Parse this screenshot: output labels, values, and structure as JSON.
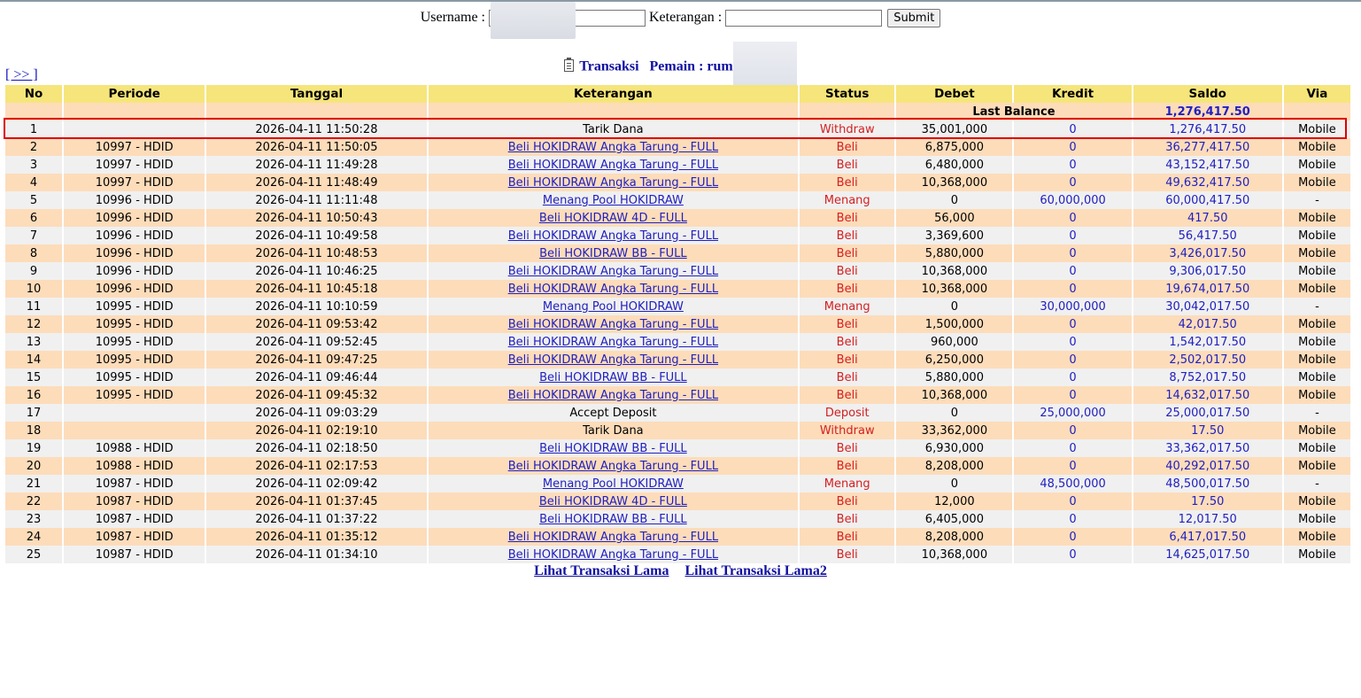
{
  "form": {
    "username_label": "Username :",
    "username_value": "",
    "keterangan_label": "Keterangan :",
    "keterangan_value": "",
    "submit_label": "Submit"
  },
  "heading": {
    "transaksi": "Transaksi",
    "pemain": "Pemain : rum",
    "icon": "clipboard-icon"
  },
  "nav_link": "[ >> ]",
  "columns": [
    "No",
    "Periode",
    "Tanggal",
    "Keterangan",
    "Status",
    "Debet",
    "Kredit",
    "Saldo",
    "Via"
  ],
  "last_balance": {
    "label": "Last Balance",
    "value": "1,276,417.50"
  },
  "rows": [
    {
      "no": "1",
      "periode": "",
      "tanggal": "2026-04-11 11:50:28",
      "keterangan": "Tarik Dana",
      "link": false,
      "status": "Withdraw",
      "debet": "35,001,000",
      "kredit": "0",
      "saldo": "1,276,417.50",
      "via": "Mobile"
    },
    {
      "no": "2",
      "periode": "10997 - HDID",
      "tanggal": "2026-04-11 11:50:05",
      "keterangan": "Beli HOKIDRAW Angka Tarung - FULL",
      "link": true,
      "status": "Beli",
      "debet": "6,875,000",
      "kredit": "0",
      "saldo": "36,277,417.50",
      "via": "Mobile"
    },
    {
      "no": "3",
      "periode": "10997 - HDID",
      "tanggal": "2026-04-11 11:49:28",
      "keterangan": "Beli HOKIDRAW Angka Tarung - FULL",
      "link": true,
      "status": "Beli",
      "debet": "6,480,000",
      "kredit": "0",
      "saldo": "43,152,417.50",
      "via": "Mobile"
    },
    {
      "no": "4",
      "periode": "10997 - HDID",
      "tanggal": "2026-04-11 11:48:49",
      "keterangan": "Beli HOKIDRAW Angka Tarung - FULL",
      "link": true,
      "status": "Beli",
      "debet": "10,368,000",
      "kredit": "0",
      "saldo": "49,632,417.50",
      "via": "Mobile"
    },
    {
      "no": "5",
      "periode": "10996 - HDID",
      "tanggal": "2026-04-11 11:11:48",
      "keterangan": "Menang Pool HOKIDRAW",
      "link": true,
      "status": "Menang",
      "debet": "0",
      "kredit": "60,000,000",
      "saldo": "60,000,417.50",
      "via": "-"
    },
    {
      "no": "6",
      "periode": "10996 - HDID",
      "tanggal": "2026-04-11 10:50:43",
      "keterangan": "Beli HOKIDRAW 4D - FULL",
      "link": true,
      "status": "Beli",
      "debet": "56,000",
      "kredit": "0",
      "saldo": "417.50",
      "via": "Mobile"
    },
    {
      "no": "7",
      "periode": "10996 - HDID",
      "tanggal": "2026-04-11 10:49:58",
      "keterangan": "Beli HOKIDRAW Angka Tarung - FULL",
      "link": true,
      "status": "Beli",
      "debet": "3,369,600",
      "kredit": "0",
      "saldo": "56,417.50",
      "via": "Mobile"
    },
    {
      "no": "8",
      "periode": "10996 - HDID",
      "tanggal": "2026-04-11 10:48:53",
      "keterangan": "Beli HOKIDRAW BB - FULL",
      "link": true,
      "status": "Beli",
      "debet": "5,880,000",
      "kredit": "0",
      "saldo": "3,426,017.50",
      "via": "Mobile"
    },
    {
      "no": "9",
      "periode": "10996 - HDID",
      "tanggal": "2026-04-11 10:46:25",
      "keterangan": "Beli HOKIDRAW Angka Tarung - FULL",
      "link": true,
      "status": "Beli",
      "debet": "10,368,000",
      "kredit": "0",
      "saldo": "9,306,017.50",
      "via": "Mobile"
    },
    {
      "no": "10",
      "periode": "10996 - HDID",
      "tanggal": "2026-04-11 10:45:18",
      "keterangan": "Beli HOKIDRAW Angka Tarung - FULL",
      "link": true,
      "status": "Beli",
      "debet": "10,368,000",
      "kredit": "0",
      "saldo": "19,674,017.50",
      "via": "Mobile"
    },
    {
      "no": "11",
      "periode": "10995 - HDID",
      "tanggal": "2026-04-11 10:10:59",
      "keterangan": "Menang Pool HOKIDRAW",
      "link": true,
      "status": "Menang",
      "debet": "0",
      "kredit": "30,000,000",
      "saldo": "30,042,017.50",
      "via": "-"
    },
    {
      "no": "12",
      "periode": "10995 - HDID",
      "tanggal": "2026-04-11 09:53:42",
      "keterangan": "Beli HOKIDRAW Angka Tarung - FULL",
      "link": true,
      "status": "Beli",
      "debet": "1,500,000",
      "kredit": "0",
      "saldo": "42,017.50",
      "via": "Mobile"
    },
    {
      "no": "13",
      "periode": "10995 - HDID",
      "tanggal": "2026-04-11 09:52:45",
      "keterangan": "Beli HOKIDRAW Angka Tarung - FULL",
      "link": true,
      "status": "Beli",
      "debet": "960,000",
      "kredit": "0",
      "saldo": "1,542,017.50",
      "via": "Mobile"
    },
    {
      "no": "14",
      "periode": "10995 - HDID",
      "tanggal": "2026-04-11 09:47:25",
      "keterangan": "Beli HOKIDRAW Angka Tarung - FULL",
      "link": true,
      "status": "Beli",
      "debet": "6,250,000",
      "kredit": "0",
      "saldo": "2,502,017.50",
      "via": "Mobile"
    },
    {
      "no": "15",
      "periode": "10995 - HDID",
      "tanggal": "2026-04-11 09:46:44",
      "keterangan": "Beli HOKIDRAW BB - FULL",
      "link": true,
      "status": "Beli",
      "debet": "5,880,000",
      "kredit": "0",
      "saldo": "8,752,017.50",
      "via": "Mobile"
    },
    {
      "no": "16",
      "periode": "10995 - HDID",
      "tanggal": "2026-04-11 09:45:32",
      "keterangan": "Beli HOKIDRAW Angka Tarung - FULL",
      "link": true,
      "status": "Beli",
      "debet": "10,368,000",
      "kredit": "0",
      "saldo": "14,632,017.50",
      "via": "Mobile"
    },
    {
      "no": "17",
      "periode": "",
      "tanggal": "2026-04-11 09:03:29",
      "keterangan": "Accept Deposit",
      "link": false,
      "status": "Deposit",
      "debet": "0",
      "kredit": "25,000,000",
      "saldo": "25,000,017.50",
      "via": "-"
    },
    {
      "no": "18",
      "periode": "",
      "tanggal": "2026-04-11 02:19:10",
      "keterangan": "Tarik Dana",
      "link": false,
      "status": "Withdraw",
      "debet": "33,362,000",
      "kredit": "0",
      "saldo": "17.50",
      "via": "Mobile"
    },
    {
      "no": "19",
      "periode": "10988 - HDID",
      "tanggal": "2026-04-11 02:18:50",
      "keterangan": "Beli HOKIDRAW BB - FULL",
      "link": true,
      "status": "Beli",
      "debet": "6,930,000",
      "kredit": "0",
      "saldo": "33,362,017.50",
      "via": "Mobile"
    },
    {
      "no": "20",
      "periode": "10988 - HDID",
      "tanggal": "2026-04-11 02:17:53",
      "keterangan": "Beli HOKIDRAW Angka Tarung - FULL",
      "link": true,
      "status": "Beli",
      "debet": "8,208,000",
      "kredit": "0",
      "saldo": "40,292,017.50",
      "via": "Mobile"
    },
    {
      "no": "21",
      "periode": "10987 - HDID",
      "tanggal": "2026-04-11 02:09:42",
      "keterangan": "Menang Pool HOKIDRAW",
      "link": true,
      "status": "Menang",
      "debet": "0",
      "kredit": "48,500,000",
      "saldo": "48,500,017.50",
      "via": "-"
    },
    {
      "no": "22",
      "periode": "10987 - HDID",
      "tanggal": "2026-04-11 01:37:45",
      "keterangan": "Beli HOKIDRAW 4D - FULL",
      "link": true,
      "status": "Beli",
      "debet": "12,000",
      "kredit": "0",
      "saldo": "17.50",
      "via": "Mobile"
    },
    {
      "no": "23",
      "periode": "10987 - HDID",
      "tanggal": "2026-04-11 01:37:22",
      "keterangan": "Beli HOKIDRAW BB - FULL",
      "link": true,
      "status": "Beli",
      "debet": "6,405,000",
      "kredit": "0",
      "saldo": "12,017.50",
      "via": "Mobile"
    },
    {
      "no": "24",
      "periode": "10987 - HDID",
      "tanggal": "2026-04-11 01:35:12",
      "keterangan": "Beli HOKIDRAW Angka Tarung - FULL",
      "link": true,
      "status": "Beli",
      "debet": "8,208,000",
      "kredit": "0",
      "saldo": "6,417,017.50",
      "via": "Mobile"
    },
    {
      "no": "25",
      "periode": "10987 - HDID",
      "tanggal": "2026-04-11 01:34:10",
      "keterangan": "Beli HOKIDRAW Angka Tarung - FULL",
      "link": true,
      "status": "Beli",
      "debet": "10,368,000",
      "kredit": "0",
      "saldo": "14,625,017.50",
      "via": "Mobile"
    }
  ],
  "bottom_links": [
    "Lihat Transaksi Lama",
    "Lihat Transaksi Lama2"
  ],
  "colors": {
    "header_bg": "#f5e57a",
    "row_gray": "#f0f0f0",
    "row_peach": "#fddcba",
    "link_blue": "#2020c0",
    "status_red": "#d42020",
    "highlight_red": "#e00000"
  }
}
